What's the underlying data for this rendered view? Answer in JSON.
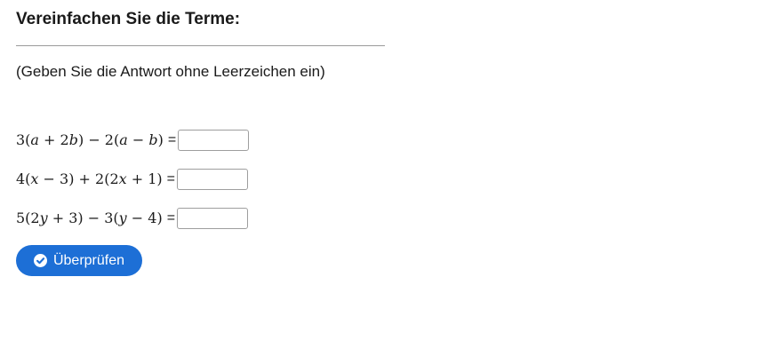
{
  "header": {
    "title": "Vereinfachen Sie die Terme:"
  },
  "instruction": "(Geben Sie die Antwort ohne Leerzeichen ein)",
  "exercises": [
    {
      "expression_parts": [
        "3(",
        "a",
        " + 2",
        "b",
        ") − 2(",
        "a",
        " − ",
        "b",
        ")"
      ],
      "equals": "=",
      "answer_value": "",
      "answer_placeholder": ""
    },
    {
      "expression_parts": [
        "4(",
        "x",
        " − 3) + 2(2",
        "x",
        " + 1)"
      ],
      "equals": "=",
      "answer_value": "",
      "answer_placeholder": ""
    },
    {
      "expression_parts": [
        "5(2",
        "y",
        " + 3) − 3(",
        "y",
        " − 4)"
      ],
      "equals": "=",
      "answer_value": "",
      "answer_placeholder": ""
    }
  ],
  "check_button": {
    "label": "Überprüfen",
    "icon": "check-circle-icon"
  },
  "colors": {
    "accent": "#1d6fd6",
    "text": "#1a1a1a",
    "rule": "#9a9a9a",
    "input_border": "#9e9e9e"
  }
}
